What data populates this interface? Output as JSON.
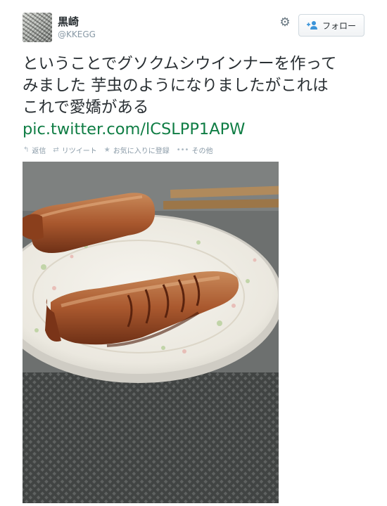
{
  "user": {
    "display_name": "黒崎",
    "screen_name": "@KKEGG"
  },
  "header": {
    "settings_icon": "gear-icon",
    "follow_icon": "follow-person-icon",
    "follow_label": "フォロー"
  },
  "tweet": {
    "line1": "ということでグソクムシウインナーを作って",
    "line2": "みました 芋虫のようになりましたがこれは",
    "line3": "これで愛嬌がある",
    "link": "pic.twitter.com/lCSLPP1APW"
  },
  "actions": {
    "reply_label": "返信",
    "retweet_label": "リツイート",
    "favorite_label": "お気に入りに登録",
    "more_label": "その他"
  },
  "colors": {
    "link": "#0f7d44",
    "text": "#292f33",
    "muted": "#8899a6"
  }
}
